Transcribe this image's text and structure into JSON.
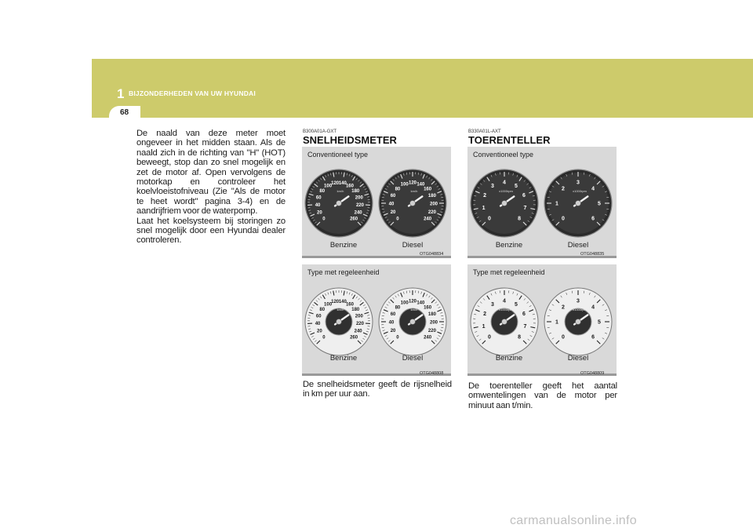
{
  "header": {
    "chapter_number": "1",
    "chapter_title": "BIJZONDERHEDEN VAN UW HYUNDAI",
    "page_number": "68"
  },
  "left_column": {
    "paragraph": "De naald van deze meter moet ongeveer in het midden staan. Als de naald zich in de richting van \"H\" (HOT) beweegt, stop dan zo snel mogelijk en zet de motor af. Open vervolgens de motorkap en controleer het koelvloeistofniveau (Zie \"Als de motor te heet wordt\" pagina 3-4) en de aandrijfriem voor de waterpomp.",
    "paragraph2": "Laat het koelsysteem bij storingen zo snel mogelijk door een Hyundai dealer controleren."
  },
  "speedometer": {
    "code": "B300A01A-GXT",
    "title": "SNELHEIDSMETER",
    "fig1": {
      "label": "Conventioneel type",
      "caption_left": "Benzine",
      "caption_right": "Diesel",
      "code": "OTG048834",
      "unit": "km/h",
      "ticks_benzine": [
        "0",
        "20",
        "40",
        "60",
        "80",
        "100",
        "120",
        "140",
        "160",
        "180",
        "200",
        "220",
        "240",
        "260"
      ],
      "ticks_diesel": [
        "0",
        "20",
        "40",
        "60",
        "80",
        "100",
        "120",
        "140",
        "160",
        "180",
        "200",
        "220",
        "240"
      ]
    },
    "fig2": {
      "label": "Type met regeleenheid",
      "caption_left": "Benzine",
      "caption_right": "Diesel",
      "code": "OTG048808",
      "unit": "km/h",
      "ticks_benzine": [
        "0",
        "20",
        "40",
        "60",
        "80",
        "100",
        "120",
        "140",
        "160",
        "180",
        "200",
        "220",
        "240",
        "260"
      ],
      "ticks_diesel": [
        "0",
        "20",
        "40",
        "60",
        "80",
        "100",
        "120",
        "140",
        "160",
        "180",
        "200",
        "220",
        "240"
      ]
    },
    "paragraph": "De snelheidsmeter geeft de rijsnelheid in km per uur aan."
  },
  "tachometer": {
    "code": "B330A01L-AXT",
    "title": "TOERENTELLER",
    "fig1": {
      "label": "Conventioneel type",
      "caption_left": "Benzine",
      "caption_right": "Diesel",
      "code": "OTG048835",
      "unit": "x1000rpm",
      "ticks_benzine": [
        "0",
        "1",
        "2",
        "3",
        "4",
        "5",
        "6",
        "7",
        "8"
      ],
      "ticks_diesel": [
        "0",
        "1",
        "2",
        "3",
        "4",
        "5",
        "6"
      ]
    },
    "fig2": {
      "label": "Type met regeleenheid",
      "caption_left": "Benzine",
      "caption_right": "Diesel",
      "code": "OTG048809",
      "unit": "x1000rpm",
      "ticks_benzine": [
        "0",
        "1",
        "2",
        "3",
        "4",
        "5",
        "6",
        "7",
        "8"
      ],
      "ticks_diesel": [
        "0",
        "1",
        "2",
        "3",
        "4",
        "5",
        "6"
      ]
    },
    "paragraph": "De toerenteller geeft het aantal omwentelingen van de motor per minuut aan t/min."
  },
  "watermark": "carmanualsonline.info",
  "colors": {
    "header_band": "#cdcb6b",
    "figure_bg": "#d9d9d9",
    "gauge_dark": "#2a2a2a"
  }
}
